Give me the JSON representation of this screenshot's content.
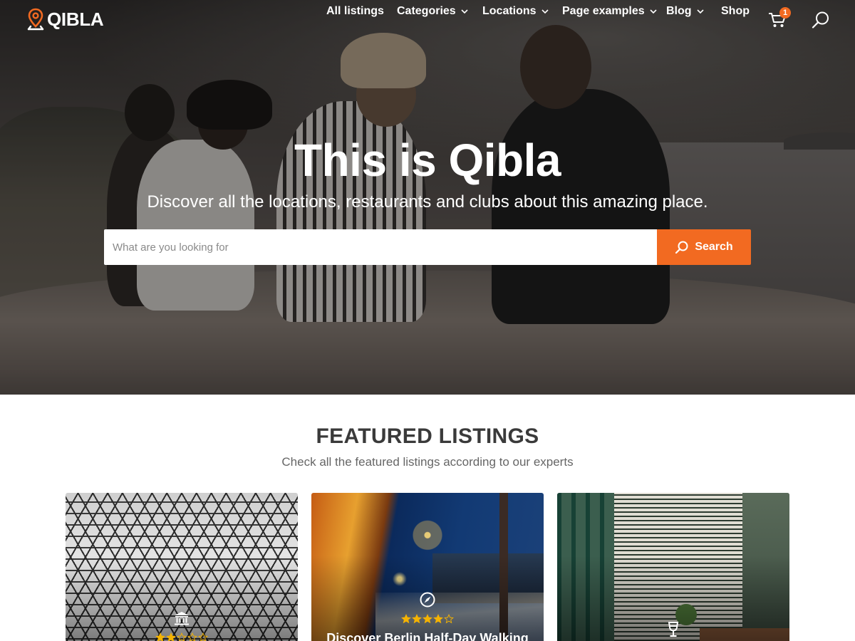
{
  "brand": {
    "name": "QIBLA",
    "accent_color": "#f26a21",
    "logo_icon": "map-pin-icon"
  },
  "nav": {
    "items": [
      {
        "label": "All listings",
        "has_dropdown": false
      },
      {
        "label": "Categories",
        "has_dropdown": true
      },
      {
        "label": "Locations",
        "has_dropdown": true
      },
      {
        "label": "Page examples",
        "has_dropdown": true
      },
      {
        "label": "Blog",
        "has_dropdown": true
      },
      {
        "label": "Shop",
        "has_dropdown": false
      }
    ],
    "cart_icon": "shopping-cart-icon",
    "cart_count": "1",
    "search_icon": "search-icon"
  },
  "hero": {
    "title": "This is Qibla",
    "subtitle": "Discover all the locations, restaurants and clubs about this amazing place.",
    "search_placeholder": "What are you looking for",
    "search_value": "",
    "search_button": "Search"
  },
  "featured": {
    "title": "FEATURED LISTINGS",
    "subtitle": "Check all the featured listings according to our experts",
    "cards": [
      {
        "category_icon": "museum-icon",
        "rating": 2,
        "max_rating": 5,
        "title": ""
      },
      {
        "category_icon": "compass-icon",
        "rating": 4,
        "max_rating": 5,
        "title": "Discover Berlin Half-Day Walking"
      },
      {
        "category_icon": "wine-glass-icon",
        "rating": null,
        "max_rating": 5,
        "title": ""
      }
    ]
  }
}
